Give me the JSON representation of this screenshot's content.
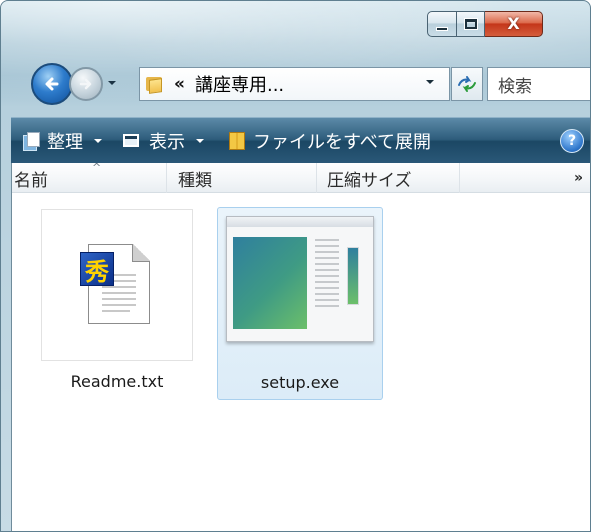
{
  "window": {
    "minimize_icon": "minimize-icon",
    "maximize_icon": "maximize-icon",
    "close_icon": "close-icon",
    "close_glyph": "X"
  },
  "navigation": {
    "back_icon": "back-arrow-icon",
    "forward_icon": "forward-arrow-icon",
    "address": {
      "chevrons": "«",
      "path": "講座専用..."
    },
    "search": {
      "placeholder": "検索"
    }
  },
  "command_bar": {
    "organize": "整理",
    "views": "表示",
    "extract_all": "ファイルをすべて展開",
    "help": "?"
  },
  "columns": {
    "name": "名前",
    "type": "種類",
    "compressed_size": "圧縮サイズ",
    "more": "»"
  },
  "files": [
    {
      "name": "Readme.txt",
      "icon": "text-document-icon",
      "badge_char": "秀",
      "selected": false
    },
    {
      "name": "setup.exe",
      "icon": "setup-application-icon",
      "selected": true
    }
  ],
  "colors": {
    "command_bar": "#2d5c7b",
    "selection": "#dcecf8",
    "close_button": "#c4361a"
  }
}
